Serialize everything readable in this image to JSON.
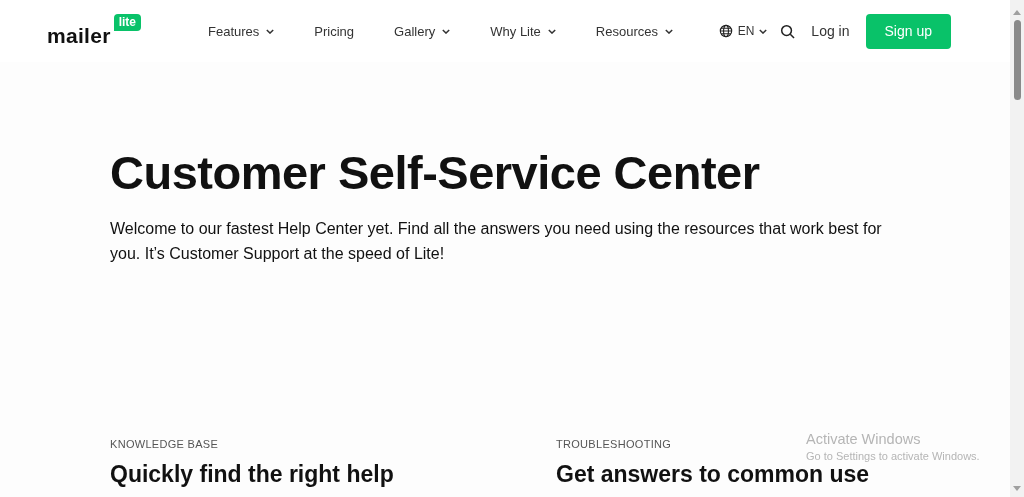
{
  "header": {
    "logo": {
      "word": "mailer",
      "badge": "lite"
    },
    "nav": [
      {
        "label": "Features",
        "dropdown": true
      },
      {
        "label": "Pricing",
        "dropdown": false
      },
      {
        "label": "Gallery",
        "dropdown": true
      },
      {
        "label": "Why Lite",
        "dropdown": true
      },
      {
        "label": "Resources",
        "dropdown": true
      }
    ],
    "language": "EN",
    "login": "Log in",
    "signup": "Sign up"
  },
  "hero": {
    "title": "Customer Self-Service Center",
    "text": "Welcome to our fastest Help Center yet. Find all the answers you need using the resources that work best for you. It’s Customer Support at the speed of Lite!"
  },
  "sections": [
    {
      "eyebrow": "KNOWLEDGE BASE",
      "heading": "Quickly find the right help"
    },
    {
      "eyebrow": "TROUBLESHOOTING",
      "heading": "Get answers to common use"
    }
  ],
  "os_overlay": {
    "title": "Activate Windows",
    "text": "Go to Settings to activate Windows."
  }
}
